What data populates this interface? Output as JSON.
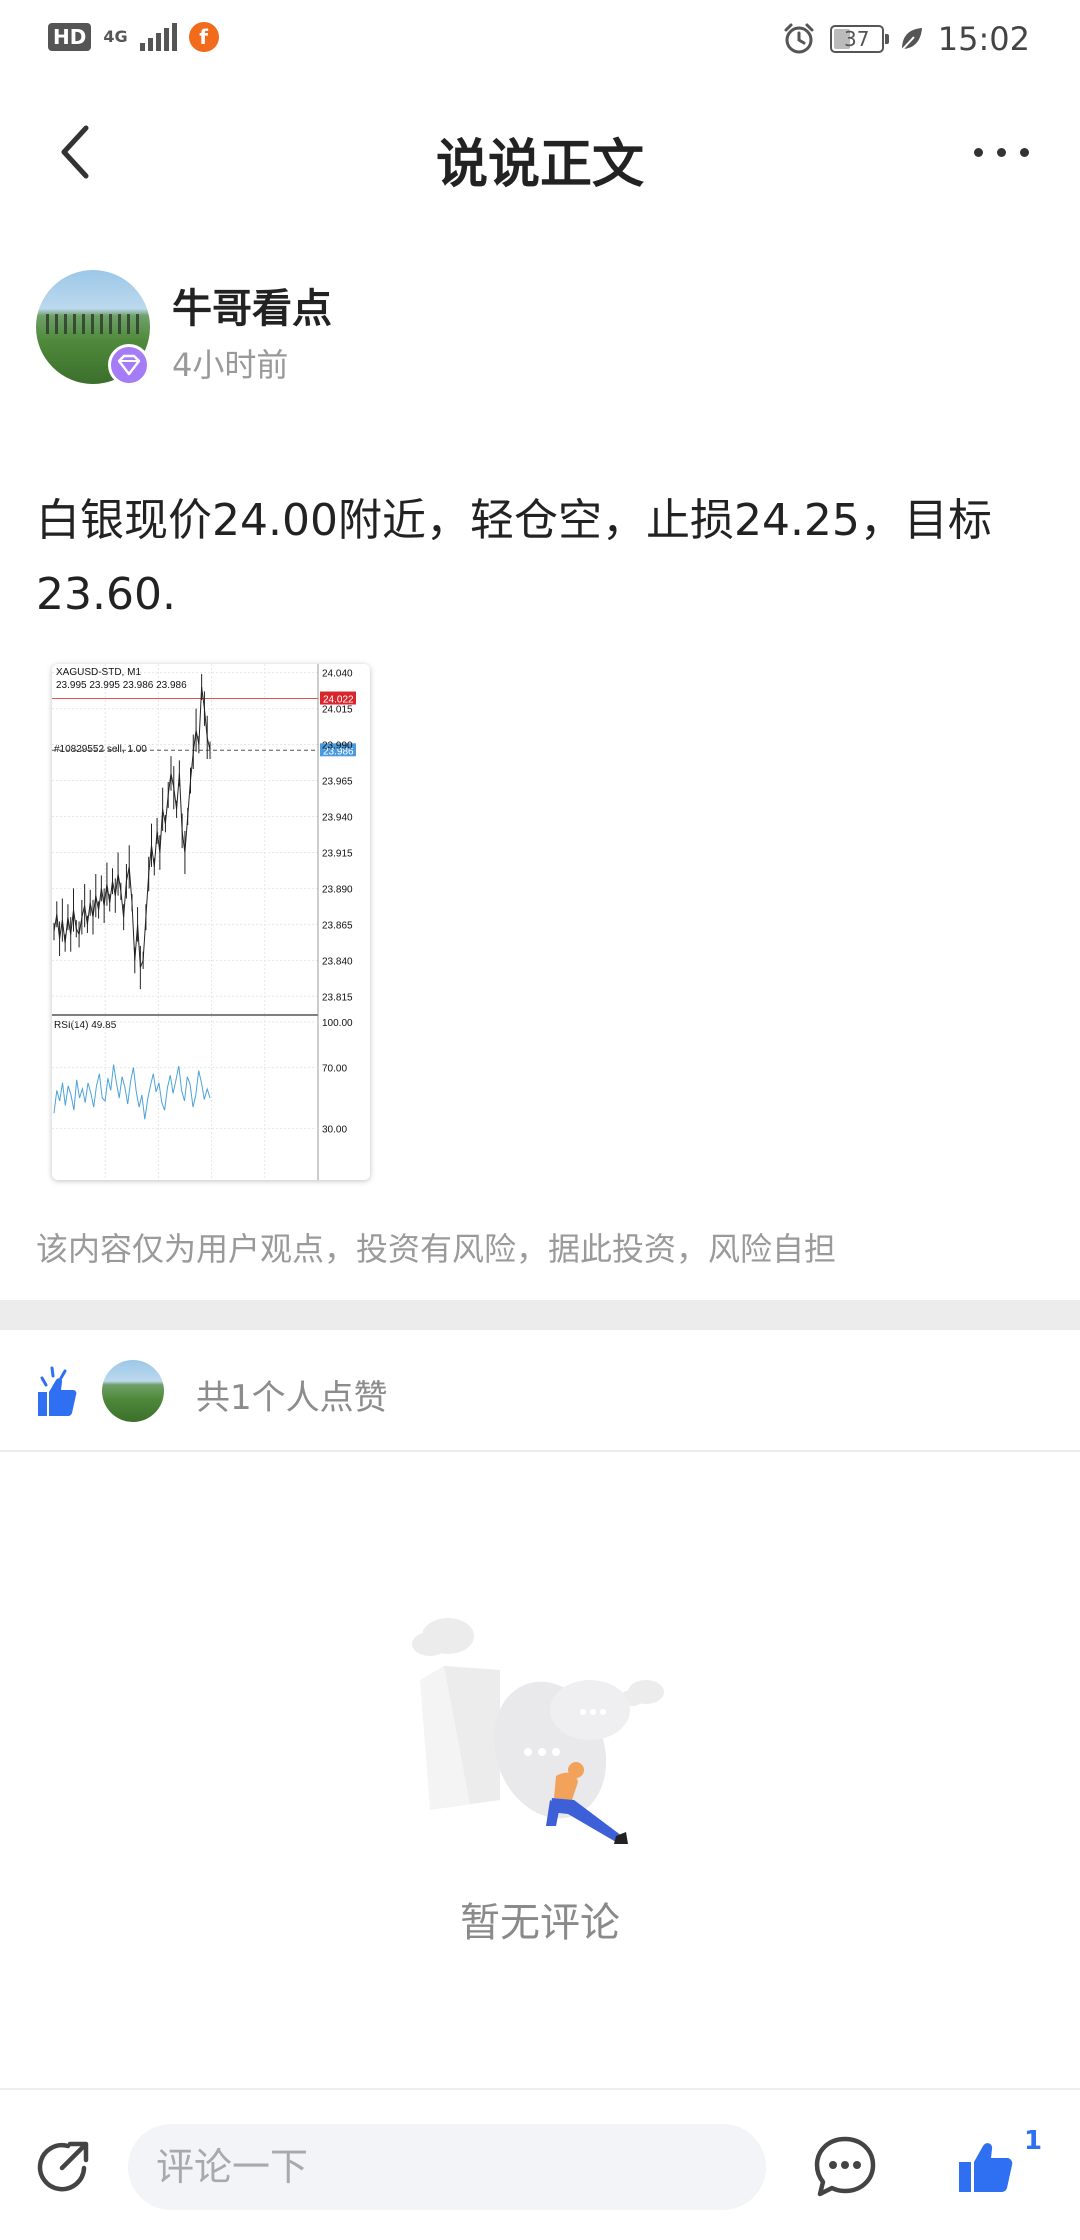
{
  "status_bar": {
    "hd": "HD",
    "network": "4G",
    "app_badge": "f",
    "battery": "37",
    "time": "15:02"
  },
  "nav": {
    "title": "说说正文",
    "back_icon": "chevron-left-icon",
    "more_icon": "more-dots-icon"
  },
  "post": {
    "author": "牛哥看点",
    "time": "4小时前",
    "text": "白银现价24.00附近，轻仓空，止损24.25，目标23.60.",
    "disclaimer": "该内容仅为用户观点，投资有风险，据此投资，风险自担"
  },
  "chart_data": {
    "type": "line",
    "title": "XAGUSD-STD, M1",
    "ohlc_header": "23.995 23.995 23.986 23.986",
    "order_label": "#10829552 sell, 1.00",
    "price_axis": [
      "24.040",
      "24.015",
      "23.990",
      "23.965",
      "23.940",
      "23.915",
      "23.890",
      "23.865",
      "23.840",
      "23.815"
    ],
    "ylim": [
      23.802,
      24.046
    ],
    "red_line_price": 24.022,
    "red_line_label": "24.022",
    "current_price": 23.986,
    "current_label": "23.986",
    "price_values": [
      23.86,
      23.872,
      23.855,
      23.868,
      23.852,
      23.87,
      23.858,
      23.875,
      23.862,
      23.858,
      23.87,
      23.878,
      23.865,
      23.88,
      23.87,
      23.885,
      23.875,
      23.89,
      23.878,
      23.893,
      23.88,
      23.895,
      23.885,
      23.9,
      23.888,
      23.87,
      23.895,
      23.905,
      23.88,
      23.84,
      23.865,
      23.835,
      23.84,
      23.87,
      23.9,
      23.92,
      23.905,
      23.93,
      23.915,
      23.945,
      23.935,
      23.955,
      23.97,
      23.96,
      23.945,
      23.97,
      23.93,
      23.915,
      23.94,
      23.965,
      23.985,
      24.0,
      23.99,
      24.03,
      24.015,
      23.995,
      23.986
    ],
    "rsi": {
      "label": "RSI(14) 49.85",
      "axis": [
        "100.00",
        "70.00",
        "30.00"
      ],
      "values": [
        40,
        55,
        48,
        60,
        45,
        58,
        52,
        42,
        62,
        50,
        56,
        47,
        60,
        53,
        44,
        58,
        66,
        50,
        48,
        63,
        55,
        72,
        60,
        50,
        64,
        57,
        46,
        61,
        70,
        54,
        44,
        52,
        36,
        49,
        58,
        66,
        54,
        60,
        47,
        42,
        57,
        65,
        53,
        62,
        71,
        55,
        48,
        64,
        59,
        44,
        52,
        68,
        60,
        49,
        56,
        50
      ]
    }
  },
  "likes": {
    "text": "共1个人点赞",
    "icon": "thumbs-up-sparkle-icon"
  },
  "empty": {
    "text": "暂无评论"
  },
  "bottom": {
    "comment_placeholder": "评论一下",
    "like_count": "1",
    "accent": "#2f6ff2"
  }
}
